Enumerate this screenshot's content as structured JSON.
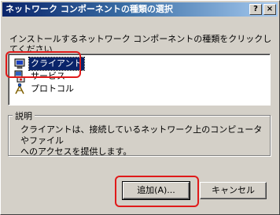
{
  "window": {
    "title": "ネットワーク コンポーネントの種類の選択",
    "help_button": "?",
    "close_button": "×"
  },
  "instruction": "インストールするネットワーク コンポーネントの種類をクリックしてください\n(C):",
  "list": {
    "items": [
      {
        "label": "クライアント",
        "icon": "client-computer-icon",
        "selected": true
      },
      {
        "label": "サービス",
        "icon": "service-icon",
        "selected": false
      },
      {
        "label": "プロトコル",
        "icon": "protocol-icon",
        "selected": false
      }
    ]
  },
  "description": {
    "legend": "説明",
    "text": "クライアントは、接続しているネットワーク上のコンピュータやファイル\nへのアクセスを提供します。"
  },
  "buttons": {
    "add": "追加(A)...",
    "cancel": "キャンセル"
  },
  "annotation_color": "#e01a1a"
}
